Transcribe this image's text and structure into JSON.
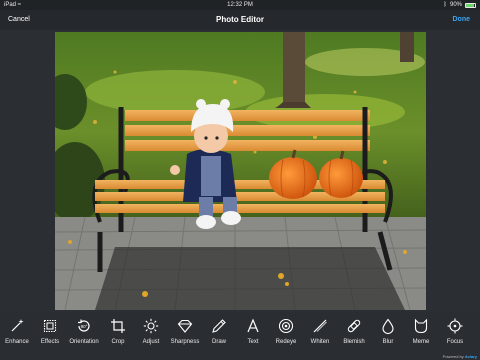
{
  "status_bar": {
    "device": "iPad",
    "time": "12:32 PM",
    "battery_text": "90%",
    "battery_level": 0.9
  },
  "nav": {
    "cancel_label": "Cancel",
    "title": "Photo Editor",
    "done_label": "Done"
  },
  "photo": {
    "description_icon": "photo-canvas"
  },
  "toolbar": {
    "tools": [
      {
        "label": "Enhance",
        "icon": "magic-wand-icon"
      },
      {
        "label": "Effects",
        "icon": "effects-icon"
      },
      {
        "label": "Orientation",
        "icon": "rotate-icon"
      },
      {
        "label": "Crop",
        "icon": "crop-icon"
      },
      {
        "label": "Adjust",
        "icon": "sun-icon"
      },
      {
        "label": "Sharpness",
        "icon": "diamond-icon"
      },
      {
        "label": "Draw",
        "icon": "pencil-icon"
      },
      {
        "label": "Text",
        "icon": "text-icon"
      },
      {
        "label": "Redeye",
        "icon": "eye-icon"
      },
      {
        "label": "Whiten",
        "icon": "brush-icon"
      },
      {
        "label": "Blemish",
        "icon": "bandage-icon"
      },
      {
        "label": "Blur",
        "icon": "drop-icon"
      },
      {
        "label": "Meme",
        "icon": "cat-icon"
      },
      {
        "label": "Focus",
        "icon": "focus-icon"
      }
    ]
  },
  "footer": {
    "powered_prefix": "Powered by",
    "powered_brand": "Aviary"
  },
  "colors": {
    "accent": "#38a4f0",
    "background": "#2b2f33"
  }
}
